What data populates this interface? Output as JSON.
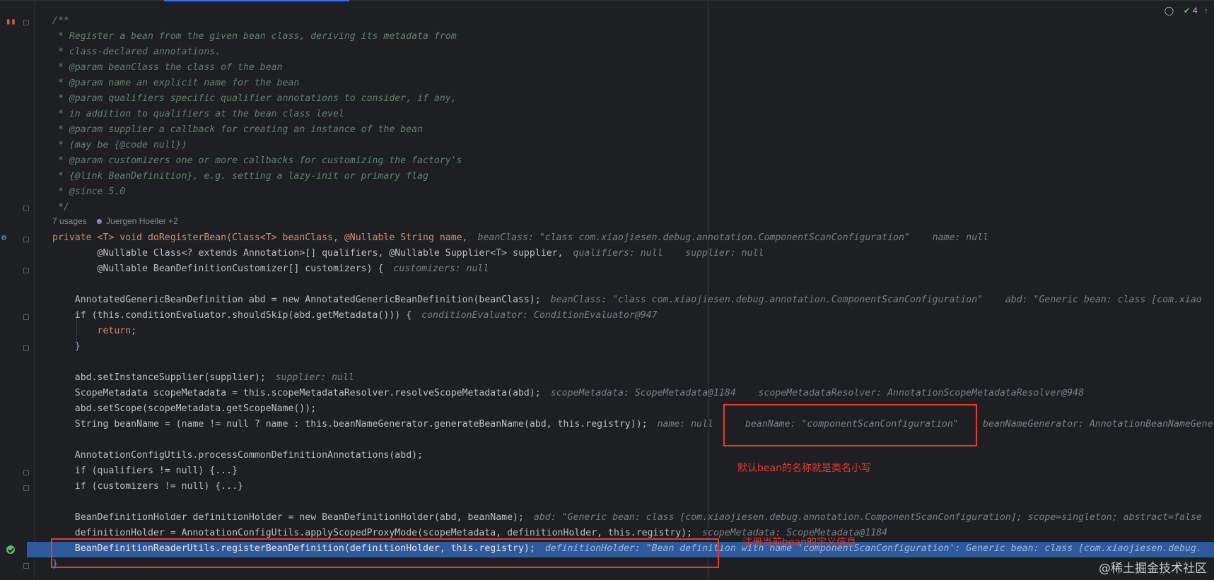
{
  "editor": {
    "inspections": {
      "count": "4"
    },
    "usages_hint": "7 usages",
    "authors_hint": "Juergen Hoeller +2",
    "comment_lines": [
      "/**",
      " * Register a bean from the given bean class, deriving its metadata from",
      " * class-declared annotations.",
      " * @param beanClass the class of the bean",
      " * @param name an explicit name for the bean",
      " * @param qualifiers specific qualifier annotations to consider, if any,",
      " * in addition to qualifiers at the bean class level",
      " * @param supplier a callback for creating an instance of the bean",
      " * (may be {@code null})",
      " * @param customizers one or more callbacks for customizing the factory's",
      " * {@link BeanDefinition}, e.g. setting a lazy-init or primary flag",
      " * @since 5.0",
      " */"
    ],
    "code": {
      "sig1": "private <T> void doRegisterBean(Class<T> beanClass, @Nullable String name,",
      "sig1_hint": "beanClass: \"class com.xiaojiesen.debug.annotation.ComponentScanConfiguration\"    name: null",
      "sig2": "        @Nullable Class<? extends Annotation>[] qualifiers, @Nullable Supplier<T> supplier,",
      "sig2_hint": "qualifiers: null    supplier: null",
      "sig3": "        @Nullable BeanDefinitionCustomizer[] customizers) {",
      "sig3_hint": "customizers: null",
      "l1": "    AnnotatedGenericBeanDefinition abd = new AnnotatedGenericBeanDefinition(beanClass);",
      "l1_hint": "beanClass: \"class com.xiaojiesen.debug.annotation.ComponentScanConfiguration\"    abd: \"Generic bean: class [com.xiao",
      "l2": "    if (this.conditionEvaluator.shouldSkip(abd.getMetadata())) {",
      "l2_hint": "conditionEvaluator: ConditionEvaluator@947",
      "l3": "        return;",
      "l4": "    }",
      "l5": "    abd.setInstanceSupplier(supplier);",
      "l5_hint": "supplier: null",
      "l6": "    ScopeMetadata scopeMetadata = this.scopeMetadataResolver.resolveScopeMetadata(abd);",
      "l6_hint": "scopeMetadata: ScopeMetadata@1184    scopeMetadataResolver: AnnotationScopeMetadataResolver@948",
      "l7": "    abd.setScope(scopeMetadata.getScopeName());",
      "l8": "    String beanName = (name != null ? name : this.beanNameGenerator.generateBeanName(abd, this.registry));",
      "l8_hint_a": "name: null",
      "l8_hint_b": "beanName: \"componentScanConfiguration\"",
      "l8_hint_c": "beanNameGenerator: AnnotationBeanNameGene",
      "l9": "    AnnotationConfigUtils.processCommonDefinitionAnnotations(abd);",
      "l10": "    if (qualifiers != null) {...}",
      "l11": "    if (customizers != null) {...}",
      "l12": "    BeanDefinitionHolder definitionHolder = new BeanDefinitionHolder(abd, beanName);",
      "l12_hint": "abd: \"Generic bean: class [com.xiaojiesen.debug.annotation.ComponentScanConfiguration]; scope=singleton; abstract=false",
      "l13": "    definitionHolder = AnnotationConfigUtils.applyScopedProxyMode(scopeMetadata, definitionHolder, this.registry);",
      "l13_hint": "scopeMetadata: ScopeMetadata@1184",
      "l14": "    BeanDefinitionReaderUtils.registerBeanDefinition(definitionHolder, this.registry);",
      "l14_hint": "definitionHolder: \"Bean definition with name 'componentScanConfiguration': Generic bean: class [com.xiaojiesen.debug.",
      "l15": "}"
    }
  },
  "annotations": {
    "note1": "默认bean的名称就是类名小写",
    "note2": "注册当前bean的定义信息",
    "box_color": "#e8382f"
  },
  "watermark": "@稀土掘金技术社区"
}
